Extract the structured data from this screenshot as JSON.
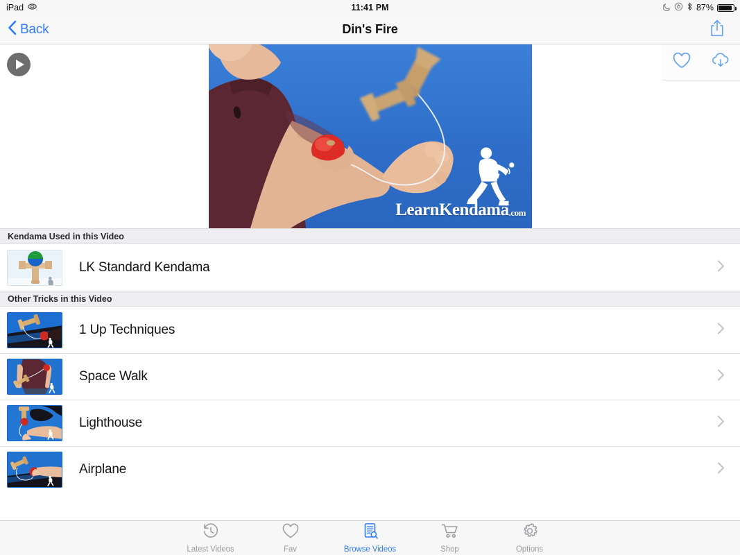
{
  "status_bar": {
    "device": "iPad",
    "wifi_icon": "wifi-icon",
    "time": "11:41 PM",
    "dnd_icon": "moon-icon",
    "rotation_lock_icon": "rotation-lock-icon",
    "bluetooth_icon": "bluetooth-icon",
    "battery_percent": "87%"
  },
  "nav_bar": {
    "back_label": "Back",
    "back_icon": "chevron-left-icon",
    "title": "Din's Fire",
    "share_icon": "share-icon"
  },
  "player": {
    "play_icon": "play-icon",
    "favorite_icon": "heart-icon",
    "download_icon": "cloud-download-icon",
    "video_watermark": "LearnKendama",
    "video_watermark_suffix": ".com"
  },
  "sections": [
    {
      "header": "Kendama Used in this Video",
      "rows": [
        {
          "label": "LK Standard Kendama",
          "thumb": "product-kendama-thumbnail",
          "disclosure": "chevron-right-icon"
        }
      ]
    },
    {
      "header": "Other Tricks in this Video",
      "rows": [
        {
          "label": "1 Up Techniques",
          "thumb": "trick-video-thumbnail",
          "disclosure": "chevron-right-icon"
        },
        {
          "label": "Space Walk",
          "thumb": "trick-video-thumbnail",
          "disclosure": "chevron-right-icon"
        },
        {
          "label": "Lighthouse",
          "thumb": "trick-video-thumbnail",
          "disclosure": "chevron-right-icon"
        },
        {
          "label": "Airplane",
          "thumb": "trick-video-thumbnail",
          "disclosure": "chevron-right-icon"
        }
      ]
    }
  ],
  "tab_bar": {
    "active_index": 2,
    "active_color": "#2f7cf6",
    "inactive_color": "#9a9aa0",
    "tabs": [
      {
        "label": "Latest Videos",
        "icon": "clock-history-icon"
      },
      {
        "label": "Fav",
        "icon": "heart-icon"
      },
      {
        "label": "Browse Videos",
        "icon": "document-search-icon"
      },
      {
        "label": "Shop",
        "icon": "shopping-cart-icon"
      },
      {
        "label": "Options",
        "icon": "gear-icon"
      }
    ]
  },
  "colors": {
    "accent": "#2f7cf6",
    "nav_bg": "#f8f8f8",
    "section_header_bg": "#eeeef2",
    "video_blue": "#2a72cf"
  }
}
